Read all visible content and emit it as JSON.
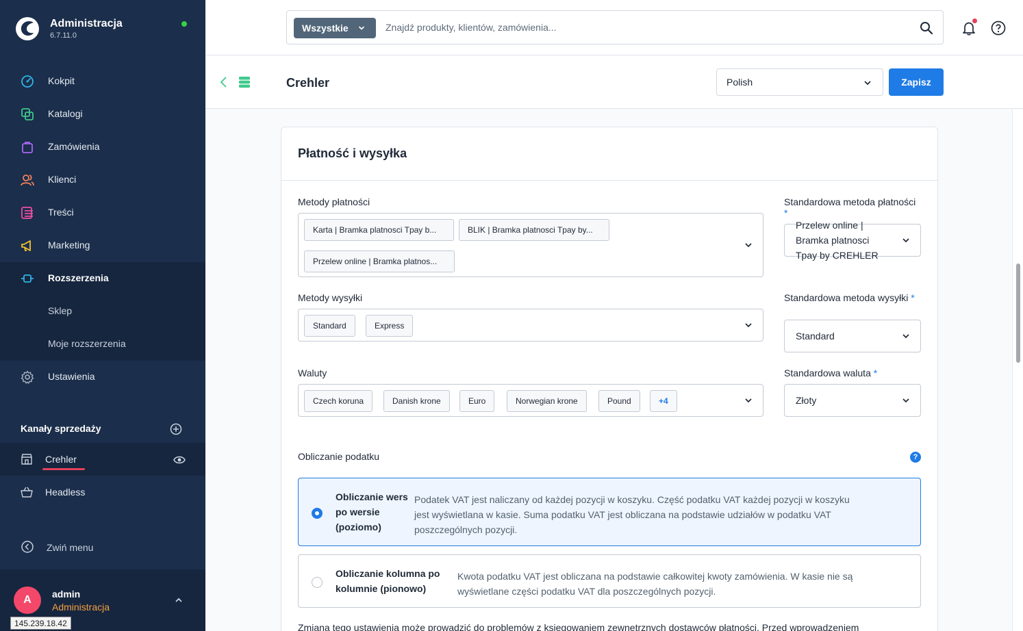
{
  "sidebar": {
    "app_title": "Administracja",
    "version": "6.7.11.0",
    "nav": [
      {
        "label": "Kokpit",
        "icon": "dashboard-icon"
      },
      {
        "label": "Katalogi",
        "icon": "catalog-icon"
      },
      {
        "label": "Zamówienia",
        "icon": "shopping-bag-icon"
      },
      {
        "label": "Klienci",
        "icon": "users-icon"
      },
      {
        "label": "Treści",
        "icon": "content-icon"
      },
      {
        "label": "Marketing",
        "icon": "megaphone-icon"
      },
      {
        "label": "Rozszerzenia",
        "icon": "plug-icon"
      }
    ],
    "sub_nav": [
      "Sklep",
      "Moje rozszerzenia"
    ],
    "settings_label": "Ustawienia",
    "channels_title": "Kanały sprzedaży",
    "channels": [
      {
        "label": "Crehler",
        "icon": "storefront-icon"
      },
      {
        "label": "Headless",
        "icon": "basket-icon"
      }
    ],
    "collapse_label": "Zwiń menu",
    "user": {
      "initial": "A",
      "name": "admin",
      "role": "Administracja"
    },
    "ip_tooltip": "145.239.18.42",
    "colors": {
      "background": "#1b2e4b",
      "accent_underline": "#e3425a",
      "online": "#37d046"
    }
  },
  "topbar": {
    "search_type": "Wszystkie",
    "search_placeholder": "Znajdź produkty, klientów, zamówienia..."
  },
  "header": {
    "title": "Crehler",
    "language": "Polish",
    "save_label": "Zapisz",
    "save_color": "#1f7be6"
  },
  "card": {
    "title": "Płatność i wysyłka",
    "payment_methods": {
      "label": "Metody płatności",
      "tags": [
        "Karta | Bramka platnosci Tpay b...",
        "BLIK | Bramka platnosci Tpay by...",
        "Przelew online | Bramka platnos..."
      ]
    },
    "default_payment": {
      "label": "Standardowa metoda płatności",
      "required": "*",
      "lines": [
        "Przelew online |",
        "Bramka platnosci",
        "Tpay by CREHLER"
      ]
    },
    "shipping_methods": {
      "label": "Metody wysyłki",
      "tags": [
        "Standard",
        "Express"
      ]
    },
    "default_shipping": {
      "label": "Standardowa metoda wysyłki",
      "required": "*",
      "value": "Standard"
    },
    "currencies": {
      "label": "Waluty",
      "tags": [
        "Czech koruna",
        "Danish krone",
        "Euro",
        "Norwegian krone",
        "Pound"
      ],
      "more": "+4"
    },
    "default_currency": {
      "label": "Standardowa waluta",
      "required": "*",
      "value": "Złoty"
    },
    "tax": {
      "label": "Obliczanie podatku",
      "help": "?",
      "options": [
        {
          "name_lines": [
            "Obliczanie wers",
            "po wersie",
            "(poziomo)"
          ],
          "desc_lines": [
            "Podatek VAT jest naliczany od każdej pozycji w koszyku. Część podatku VAT każdej pozycji w koszyku",
            "jest wyświetlana w kasie. Suma podatku VAT jest obliczana na podstawie udziałów w podatku VAT",
            "poszczególnych pozycji."
          ],
          "selected": true
        },
        {
          "name_lines": [
            "Obliczanie kolumna po",
            "kolumnie (pionowo)"
          ],
          "desc_lines": [
            "Kwota podatku VAT jest obliczana na podstawie całkowitej kwoty zamówienia. W kasie nie są",
            "wyświetlane części podatku VAT dla poszczególnych pozycji."
          ],
          "selected": false
        }
      ]
    },
    "warning": "Zmiana tego ustawienia może prowadzić do problemów z księgowaniem zewnętrznych dostawców płatności. Przed wprowadzeniem"
  }
}
